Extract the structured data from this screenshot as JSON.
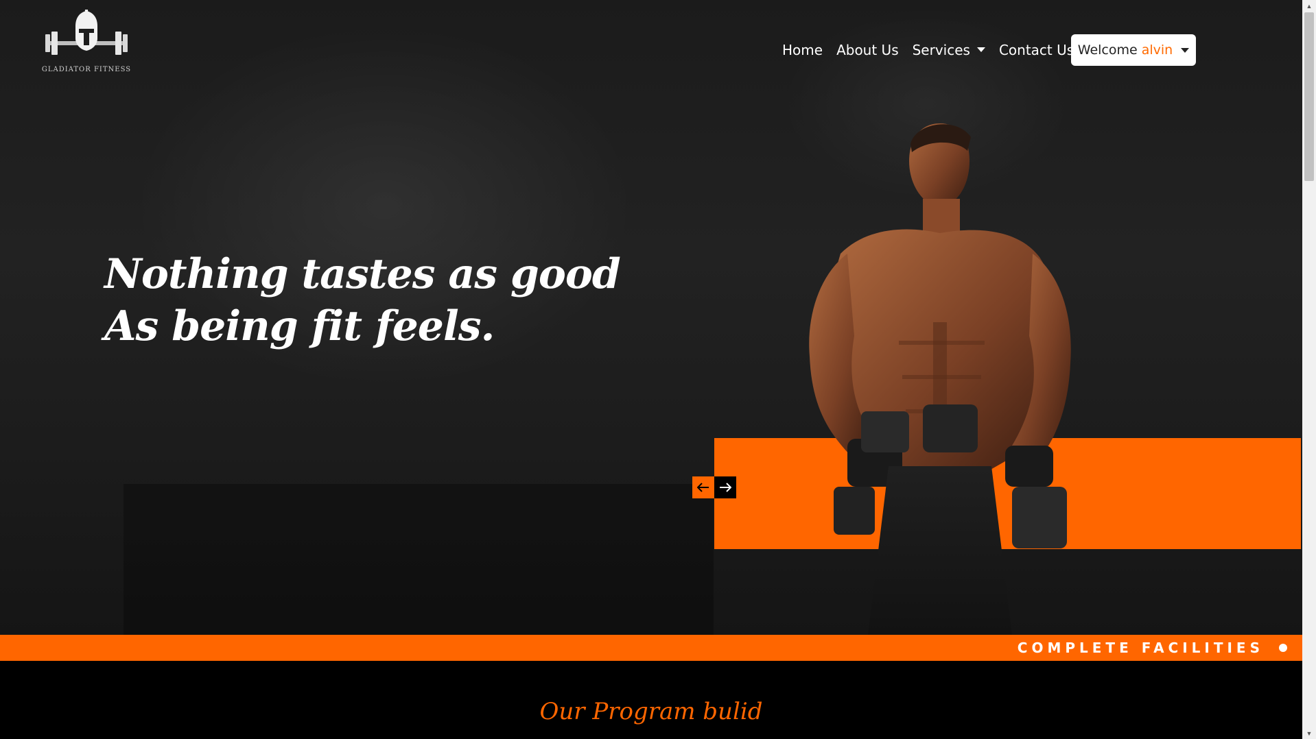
{
  "brand": {
    "logo_text": "GLADIATOR FITNESS"
  },
  "nav": {
    "items": [
      "Home",
      "About Us",
      "Services",
      "Contact Us"
    ],
    "welcome": "Welcome",
    "username": "alvin"
  },
  "hero": {
    "headline_line1": "Nothing tastes as good",
    "headline_line2": "As being fit feels."
  },
  "ticker": {
    "text": "COMPLETE FACILITIES"
  },
  "program": {
    "title": "Our Program bulid"
  },
  "colors": {
    "accent": "#ff6600",
    "background": "#000000"
  },
  "icons": [
    "gladiator-helmet-icon",
    "arrow-left-icon",
    "arrow-right-icon",
    "caret-down-icon"
  ]
}
